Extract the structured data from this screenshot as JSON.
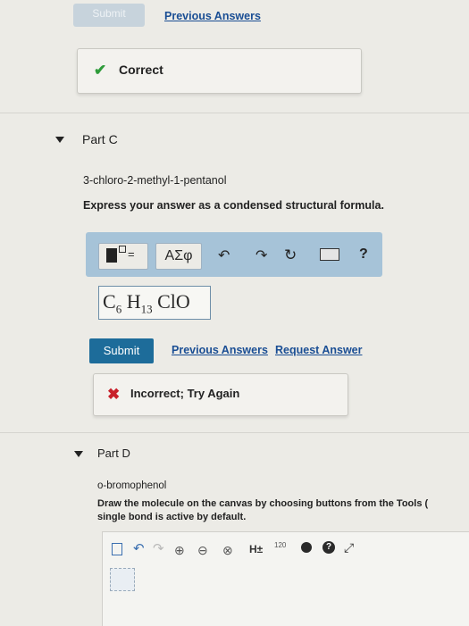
{
  "prev_section": {
    "submit_label": "Submit",
    "previous_answers_label": "Previous Answers",
    "feedback": "Correct"
  },
  "part_c": {
    "title": "Part C",
    "compound": "3-chloro-2-methyl-1-pentanol",
    "instruction": "Express your answer as a condensed structural formula.",
    "toolbar": {
      "templates_icon": "templates-icon",
      "greek_label": "ΑΣφ",
      "undo_icon": "undo-icon",
      "redo_icon": "redo-icon",
      "reset_icon": "reset-icon",
      "keyboard_icon": "keyboard-icon",
      "help_label": "?"
    },
    "answer": {
      "c": "C",
      "c_sub": "6",
      "h": "H",
      "h_sub": "13",
      "rest": "ClO"
    },
    "submit_label": "Submit",
    "previous_answers_label": "Previous Answers",
    "request_answer_label": "Request Answer",
    "feedback": "Incorrect; Try Again",
    "colors": {
      "correct": "#2e9b3a",
      "incorrect": "#c8202a",
      "submit": "#1d6c9a",
      "toolbar": "#a6c3d8",
      "link": "#1a4e94"
    }
  },
  "part_d": {
    "title": "Part D",
    "compound": "o-bromophenol",
    "instruction_line1": "Draw the molecule on the canvas by choosing buttons from the Tools (",
    "instruction_line2": "single bond is active by default.",
    "tools": {
      "new_icon": "new-document-icon",
      "undo_icon": "undo-icon",
      "redo_icon": "redo-icon",
      "zoom_in_icon": "zoom-in-icon",
      "zoom_out_icon": "zoom-out-icon",
      "clear_icon": "clear-icon",
      "h_label": "H±",
      "num_label": "120",
      "info_icon": "info-icon",
      "help_icon": "help-icon",
      "fullscreen_icon": "fullscreen-icon"
    }
  }
}
